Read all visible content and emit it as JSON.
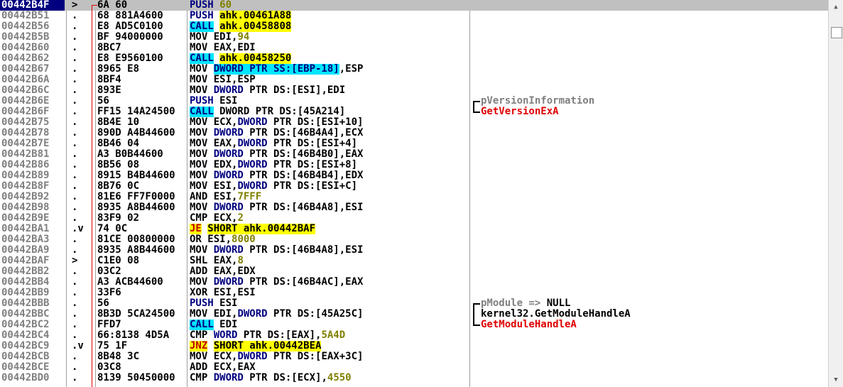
{
  "rows": [
    {
      "addr": "00442B4F",
      "mark": ">",
      "hex": "6A 60",
      "selected": true,
      "dis": [
        {
          "t": "PUSH",
          "c": "mn-n"
        },
        {
          "t": " "
        },
        {
          "t": "60",
          "c": "num"
        }
      ],
      "comment": []
    },
    {
      "addr": "00442B51",
      "mark": ".",
      "hex": "68 881A4600",
      "dis": [
        {
          "t": "PUSH",
          "c": "mn-n"
        },
        {
          "t": " "
        },
        {
          "t": "ahk.00461A88",
          "c": "hl-y"
        }
      ],
      "comment": []
    },
    {
      "addr": "00442B56",
      "mark": ".",
      "hex": "E8 AD5C0100",
      "dis": [
        {
          "t": "CALL",
          "c": "hl-c mn-n"
        },
        {
          "t": " "
        },
        {
          "t": "ahk.00458808",
          "c": "hl-y"
        }
      ],
      "comment": []
    },
    {
      "addr": "00442B5B",
      "mark": ".",
      "hex": "BF 94000000",
      "dis": [
        {
          "t": "MOV EDI,"
        },
        {
          "t": "94",
          "c": "num"
        }
      ],
      "comment": []
    },
    {
      "addr": "00442B60",
      "mark": ".",
      "hex": "8BC7",
      "dis": [
        {
          "t": "MOV EAX,EDI"
        }
      ],
      "comment": []
    },
    {
      "addr": "00442B62",
      "mark": ".",
      "hex": "E8 E9560100",
      "dis": [
        {
          "t": "CALL",
          "c": "hl-c mn-n"
        },
        {
          "t": " "
        },
        {
          "t": "ahk.00458250",
          "c": "hl-y"
        }
      ],
      "comment": []
    },
    {
      "addr": "00442B67",
      "mark": ".",
      "hex": "8965 E8",
      "dis": [
        {
          "t": "MOV "
        },
        {
          "t": "DWORD PTR SS:[EBP-18]",
          "c": "hl-c mn-n"
        },
        {
          "t": ",ESP"
        }
      ],
      "comment": []
    },
    {
      "addr": "00442B6A",
      "mark": ".",
      "hex": "8BF4",
      "dis": [
        {
          "t": "MOV ESI,ESP"
        }
      ],
      "comment": []
    },
    {
      "addr": "00442B6C",
      "mark": ".",
      "hex": "893E",
      "dis": [
        {
          "t": "MOV "
        },
        {
          "t": "DWORD",
          "c": "mn-n"
        },
        {
          "t": " PTR DS:[ESI],EDI"
        }
      ],
      "comment": []
    },
    {
      "addr": "00442B6E",
      "mark": ".",
      "hex": "56",
      "dis": [
        {
          "t": "PUSH",
          "c": "mn-n"
        },
        {
          "t": " ESI"
        }
      ],
      "comment": [
        {
          "t": "pVersionInformation",
          "c": "cmt-gray"
        }
      ],
      "brk": "top"
    },
    {
      "addr": "00442B6F",
      "mark": ".",
      "hex": "FF15 14A24500",
      "dis": [
        {
          "t": "CALL",
          "c": "hl-c mn-n"
        },
        {
          "t": " DWORD PTR DS:[45A214]"
        }
      ],
      "comment": [
        {
          "t": "GetVersionExA",
          "c": "cmt-red"
        }
      ],
      "brk": "bottom"
    },
    {
      "addr": "00442B75",
      "mark": ".",
      "hex": "8B4E 10",
      "dis": [
        {
          "t": "MOV ECX,"
        },
        {
          "t": "DWORD",
          "c": "mn-n"
        },
        {
          "t": " PTR DS:[ESI+10]"
        }
      ],
      "comment": []
    },
    {
      "addr": "00442B78",
      "mark": ".",
      "hex": "890D A4B44600",
      "dis": [
        {
          "t": "MOV "
        },
        {
          "t": "DWORD",
          "c": "mn-n"
        },
        {
          "t": " PTR DS:[46B4A4],ECX"
        }
      ],
      "comment": []
    },
    {
      "addr": "00442B7E",
      "mark": ".",
      "hex": "8B46 04",
      "dis": [
        {
          "t": "MOV EAX,"
        },
        {
          "t": "DWORD",
          "c": "mn-n"
        },
        {
          "t": " PTR DS:[ESI+4]"
        }
      ],
      "comment": []
    },
    {
      "addr": "00442B81",
      "mark": ".",
      "hex": "A3 B0B44600",
      "dis": [
        {
          "t": "MOV "
        },
        {
          "t": "DWORD",
          "c": "mn-n"
        },
        {
          "t": " PTR DS:[46B4B0],EAX"
        }
      ],
      "comment": []
    },
    {
      "addr": "00442B86",
      "mark": ".",
      "hex": "8B56 08",
      "dis": [
        {
          "t": "MOV EDX,"
        },
        {
          "t": "DWORD",
          "c": "mn-n"
        },
        {
          "t": " PTR DS:[ESI+8]"
        }
      ],
      "comment": []
    },
    {
      "addr": "00442B89",
      "mark": ".",
      "hex": "8915 B4B44600",
      "dis": [
        {
          "t": "MOV "
        },
        {
          "t": "DWORD",
          "c": "mn-n"
        },
        {
          "t": " PTR DS:[46B4B4],EDX"
        }
      ],
      "comment": []
    },
    {
      "addr": "00442B8F",
      "mark": ".",
      "hex": "8B76 0C",
      "dis": [
        {
          "t": "MOV ESI,"
        },
        {
          "t": "DWORD",
          "c": "mn-n"
        },
        {
          "t": " PTR DS:[ESI+C]"
        }
      ],
      "comment": []
    },
    {
      "addr": "00442B92",
      "mark": ".",
      "hex": "81E6 FF7F0000",
      "dis": [
        {
          "t": "AND ESI,"
        },
        {
          "t": "7FFF",
          "c": "num"
        }
      ],
      "comment": []
    },
    {
      "addr": "00442B98",
      "mark": ".",
      "hex": "8935 A8B44600",
      "dis": [
        {
          "t": "MOV "
        },
        {
          "t": "DWORD",
          "c": "mn-n"
        },
        {
          "t": " PTR DS:[46B4A8],ESI"
        }
      ],
      "comment": []
    },
    {
      "addr": "00442B9E",
      "mark": ".",
      "hex": "83F9 02",
      "dis": [
        {
          "t": "CMP ECX,"
        },
        {
          "t": "2",
          "c": "num"
        }
      ],
      "comment": []
    },
    {
      "addr": "00442BA1",
      "mark": ".v",
      "hex": "74 0C",
      "dis": [
        {
          "t": "JE",
          "c": "hl-y mn-j"
        },
        {
          "t": " "
        },
        {
          "t": "SHORT ahk.00442BAF",
          "c": "hl-y"
        }
      ],
      "comment": []
    },
    {
      "addr": "00442BA3",
      "mark": ".",
      "hex": "81CE 00800000",
      "dis": [
        {
          "t": "OR ESI,"
        },
        {
          "t": "8000",
          "c": "num"
        }
      ],
      "comment": []
    },
    {
      "addr": "00442BA9",
      "mark": ".",
      "hex": "8935 A8B44600",
      "dis": [
        {
          "t": "MOV "
        },
        {
          "t": "DWORD",
          "c": "mn-n"
        },
        {
          "t": " PTR DS:[46B4A8],ESI"
        }
      ],
      "comment": []
    },
    {
      "addr": "00442BAF",
      "mark": ">",
      "hex": "C1E0 08",
      "dis": [
        {
          "t": "SHL EAX,"
        },
        {
          "t": "8",
          "c": "num"
        }
      ],
      "comment": []
    },
    {
      "addr": "00442BB2",
      "mark": ".",
      "hex": "03C2",
      "dis": [
        {
          "t": "ADD EAX,EDX"
        }
      ],
      "comment": []
    },
    {
      "addr": "00442BB4",
      "mark": ".",
      "hex": "A3 ACB44600",
      "dis": [
        {
          "t": "MOV "
        },
        {
          "t": "DWORD",
          "c": "mn-n"
        },
        {
          "t": " PTR DS:[46B4AC],EAX"
        }
      ],
      "comment": []
    },
    {
      "addr": "00442BB9",
      "mark": ".",
      "hex": "33F6",
      "dis": [
        {
          "t": "XOR ESI,ESI"
        }
      ],
      "comment": []
    },
    {
      "addr": "00442BBB",
      "mark": ".",
      "hex": "56",
      "dis": [
        {
          "t": "PUSH",
          "c": "mn-n"
        },
        {
          "t": " ESI"
        }
      ],
      "comment": [
        {
          "t": "pModule => ",
          "c": "cmt-gray"
        },
        {
          "t": "NULL",
          "c": "cmt-black"
        }
      ],
      "brk": "top"
    },
    {
      "addr": "00442BBC",
      "mark": ".",
      "hex": "8B3D 5CA24500",
      "dis": [
        {
          "t": "MOV EDI,"
        },
        {
          "t": "DWORD",
          "c": "mn-n"
        },
        {
          "t": " PTR DS:[45A25C]"
        }
      ],
      "comment": [
        {
          "t": "kernel32.GetModuleHandleA",
          "c": "cmt-black"
        }
      ],
      "brk": "mid"
    },
    {
      "addr": "00442BC2",
      "mark": ".",
      "hex": "FFD7",
      "dis": [
        {
          "t": "CALL",
          "c": "hl-c mn-n"
        },
        {
          "t": " EDI"
        }
      ],
      "comment": [
        {
          "t": "GetModuleHandleA",
          "c": "cmt-red"
        }
      ],
      "brk": "bottom"
    },
    {
      "addr": "00442BC4",
      "mark": ".",
      "hex": "66:8138 4D5A",
      "dis": [
        {
          "t": "CMP "
        },
        {
          "t": "WORD",
          "c": "mn-n"
        },
        {
          "t": " PTR DS:[EAX],"
        },
        {
          "t": "5A4D",
          "c": "num"
        }
      ],
      "comment": []
    },
    {
      "addr": "00442BC9",
      "mark": ".v",
      "hex": "75 1F",
      "dis": [
        {
          "t": "JNZ",
          "c": "hl-y mn-j"
        },
        {
          "t": " "
        },
        {
          "t": "SHORT ahk.00442BEA",
          "c": "hl-y"
        }
      ],
      "comment": []
    },
    {
      "addr": "00442BCB",
      "mark": ".",
      "hex": "8B48 3C",
      "dis": [
        {
          "t": "MOV ECX,"
        },
        {
          "t": "DWORD",
          "c": "mn-n"
        },
        {
          "t": " PTR DS:[EAX+3C]"
        }
      ],
      "comment": []
    },
    {
      "addr": "00442BCE",
      "mark": ".",
      "hex": "03C8",
      "dis": [
        {
          "t": "ADD ECX,EAX"
        }
      ],
      "comment": []
    },
    {
      "addr": "00442BD0",
      "mark": ".",
      "hex": "8139 50450000",
      "dis": [
        {
          "t": "CMP "
        },
        {
          "t": "DWORD",
          "c": "mn-n"
        },
        {
          "t": " PTR DS:[ECX],"
        },
        {
          "t": "4550",
          "c": "num"
        }
      ],
      "comment": []
    }
  ],
  "scrollbar": {
    "up_icon": "arrow-up-icon",
    "down_icon": "arrow-down-icon"
  }
}
